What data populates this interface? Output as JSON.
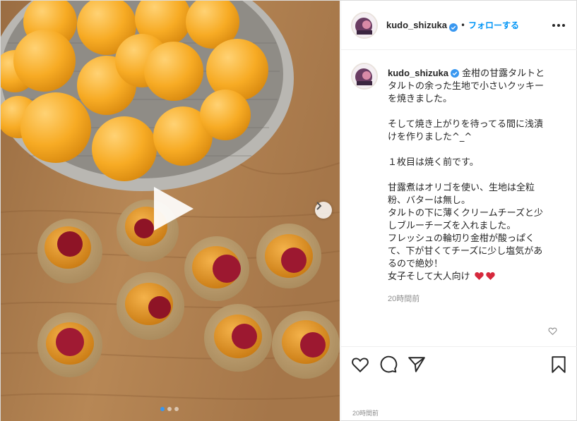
{
  "header": {
    "username": "kudo_shizuka",
    "separator": "•",
    "follow_label": "フォローする"
  },
  "caption": {
    "username": "kudo_shizuka",
    "lines": [
      "金柑の甘露タルトと",
      "タルトの余った生地で小さいクッキー",
      "を焼きました。",
      "",
      "そして焼き上がりを待ってる間に浅漬",
      "けを作りました^_^",
      "",
      "１枚目は焼く前です。",
      "",
      "甘露煮はオリゴを使い、生地は全粒",
      "粉、バターは無し。",
      "タルトの下に薄くクリームチーズと少",
      "しブルーチーズを入れました。",
      "フレッシュの輪切り金柑が酸っぱく",
      "て、下が甘くてチーズに少し塩気があ",
      "るので絶妙！",
      "女子そして大人向け"
    ],
    "time_ago": "20時間前"
  },
  "footer": {
    "post_time": "20時間前"
  },
  "media": {
    "carousel_total": 3,
    "carousel_active": 1
  },
  "icons": {
    "verified": "verified-badge-icon",
    "like": "heart-outline-icon",
    "comment": "comment-bubble-icon",
    "share": "paper-plane-icon",
    "save": "bookmark-icon",
    "more": "ellipsis-icon",
    "play": "play-icon",
    "next": "chevron-right-icon",
    "emoji_hearts": "red-heart-icon"
  },
  "colors": {
    "follow": "#0095f6",
    "verified": "#3897f0",
    "heart_emoji": "#d6283c",
    "secondary_text": "#8e8e8e"
  }
}
